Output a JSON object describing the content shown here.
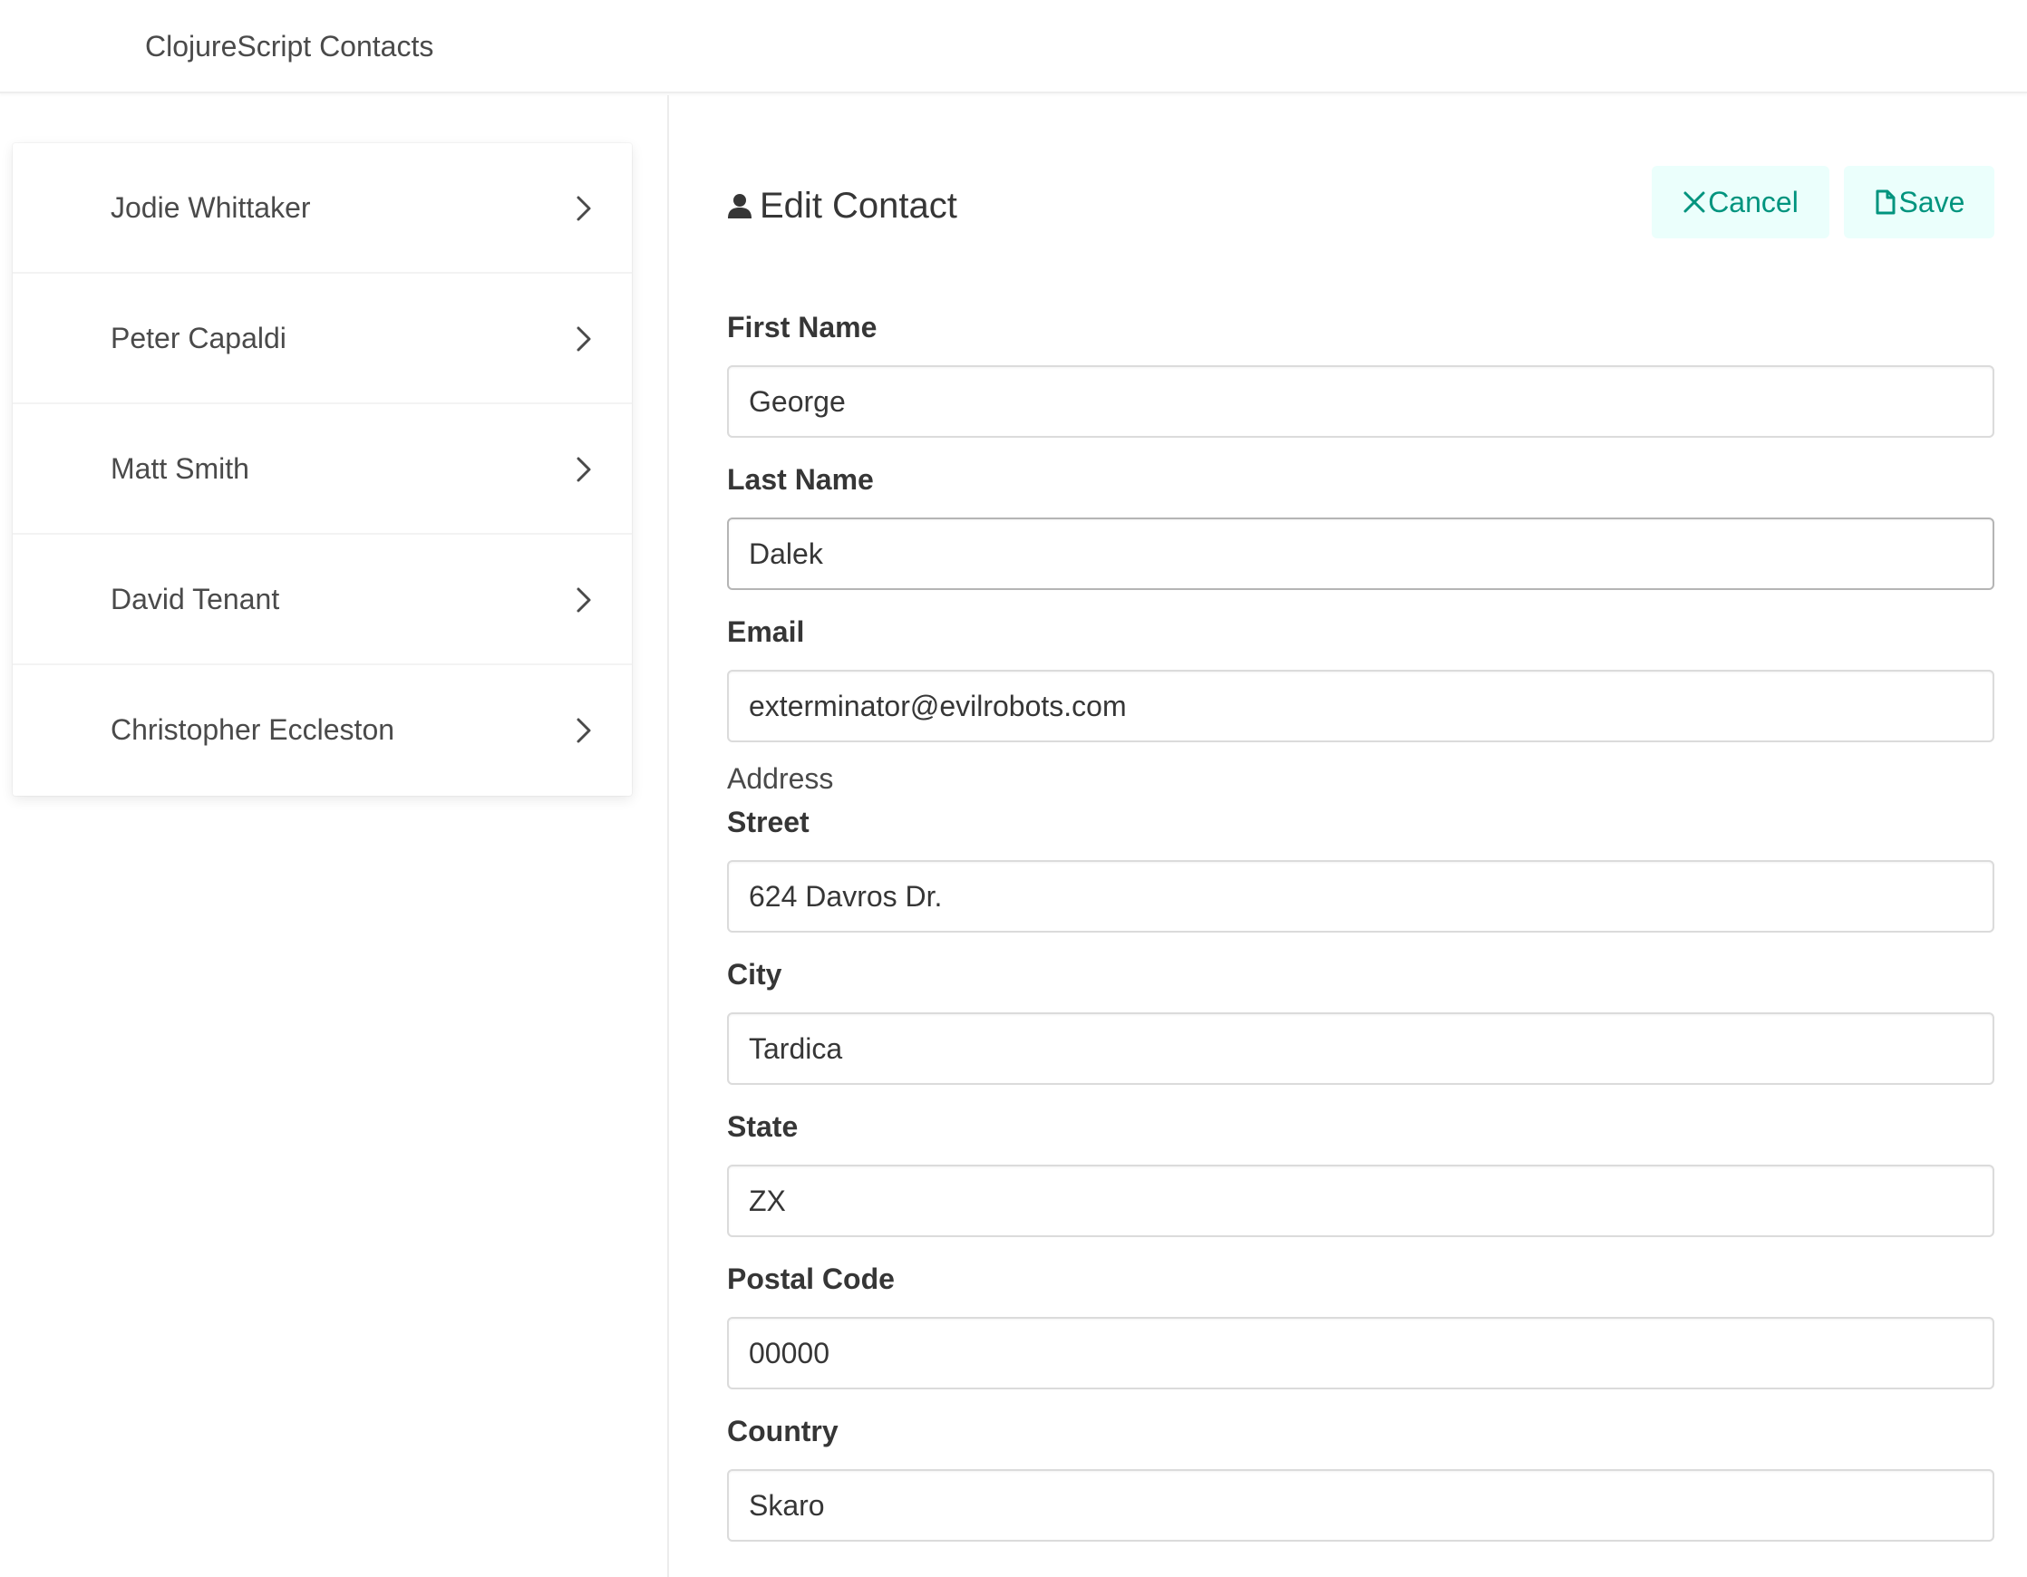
{
  "app": {
    "title": "ClojureScript Contacts"
  },
  "contacts": [
    {
      "name": "Jodie Whittaker"
    },
    {
      "name": "Peter Capaldi"
    },
    {
      "name": "Matt Smith"
    },
    {
      "name": "David Tenant"
    },
    {
      "name": "Christopher Eccleston"
    }
  ],
  "edit": {
    "title": "Edit Contact",
    "cancel_label": "Cancel",
    "save_label": "Save",
    "accent_color": "#00947e",
    "button_bg": "#ebfffc"
  },
  "form": {
    "first_name": {
      "label": "First Name",
      "value": "George"
    },
    "last_name": {
      "label": "Last Name",
      "value": "Dalek"
    },
    "email": {
      "label": "Email",
      "value": "exterminator@evilrobots.com"
    },
    "address_section": "Address",
    "street": {
      "label": "Street",
      "value": "624 Davros Dr."
    },
    "city": {
      "label": "City",
      "value": "Tardica"
    },
    "state": {
      "label": "State",
      "value": "ZX"
    },
    "postal_code": {
      "label": "Postal Code",
      "value": "00000"
    },
    "country": {
      "label": "Country",
      "value": "Skaro"
    }
  },
  "icons": {
    "contact_chevron": "chevron-right-icon",
    "edit_title": "user-icon",
    "cancel": "close-icon",
    "save": "file-icon"
  }
}
